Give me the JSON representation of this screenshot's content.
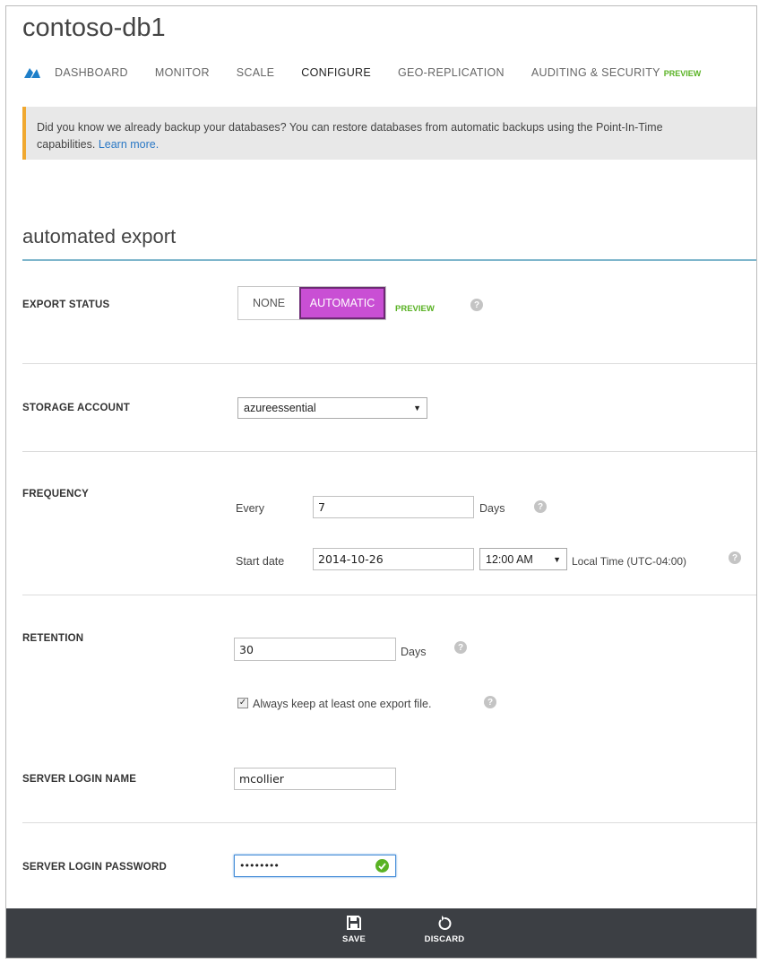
{
  "page": {
    "title": "contoso-db1"
  },
  "nav": {
    "tabs": [
      {
        "label": "DASHBOARD"
      },
      {
        "label": "MONITOR"
      },
      {
        "label": "SCALE"
      },
      {
        "label": "CONFIGURE"
      },
      {
        "label": "GEO-REPLICATION"
      },
      {
        "label": "AUDITING & SECURITY"
      }
    ],
    "active_tab": "CONFIGURE",
    "preview_badge": "PREVIEW"
  },
  "banner": {
    "text": "Did you know we already backup your databases? You can restore databases from automatic backups using the Point-In-Time",
    "text2": "capabilities.",
    "link": "Learn more."
  },
  "section": {
    "title": "automated export"
  },
  "export_status": {
    "label": "EXPORT STATUS",
    "options": [
      "NONE",
      "AUTOMATIC"
    ],
    "selected": "AUTOMATIC",
    "badge": "PREVIEW"
  },
  "storage_account": {
    "label": "STORAGE ACCOUNT",
    "value": "azureessential"
  },
  "frequency": {
    "label": "FREQUENCY",
    "every_label": "Every",
    "every_value": "7",
    "days_label": "Days",
    "start_label": "Start date",
    "start_date": "2014-10-26",
    "time": "12:00 AM",
    "timezone": "Local Time (UTC-04:00)"
  },
  "retention": {
    "label": "RETENTION",
    "value": "30",
    "days_label": "Days",
    "keep_label": "Always keep at least one export file.",
    "keep_checked": true
  },
  "login": {
    "label": "SERVER LOGIN NAME",
    "value": "mcollier"
  },
  "password": {
    "label": "SERVER LOGIN PASSWORD",
    "value": "••••••••"
  },
  "footer": {
    "save": "SAVE",
    "discard": "DISCARD"
  },
  "colors": {
    "accent": "#c94fd4",
    "preview_green": "#59b224",
    "banner_stripe": "#f0a830",
    "footer_bg": "#3c3f44"
  },
  "icons": {
    "logo": "sql-database-icon",
    "help": "question-icon",
    "save": "save-icon",
    "discard": "undo-icon",
    "valid": "checkmark-icon",
    "dropdown": "chevron-down-icon"
  },
  "help_glyph": "?",
  "check_glyph": "✓",
  "dropdown_glyph": "▼"
}
